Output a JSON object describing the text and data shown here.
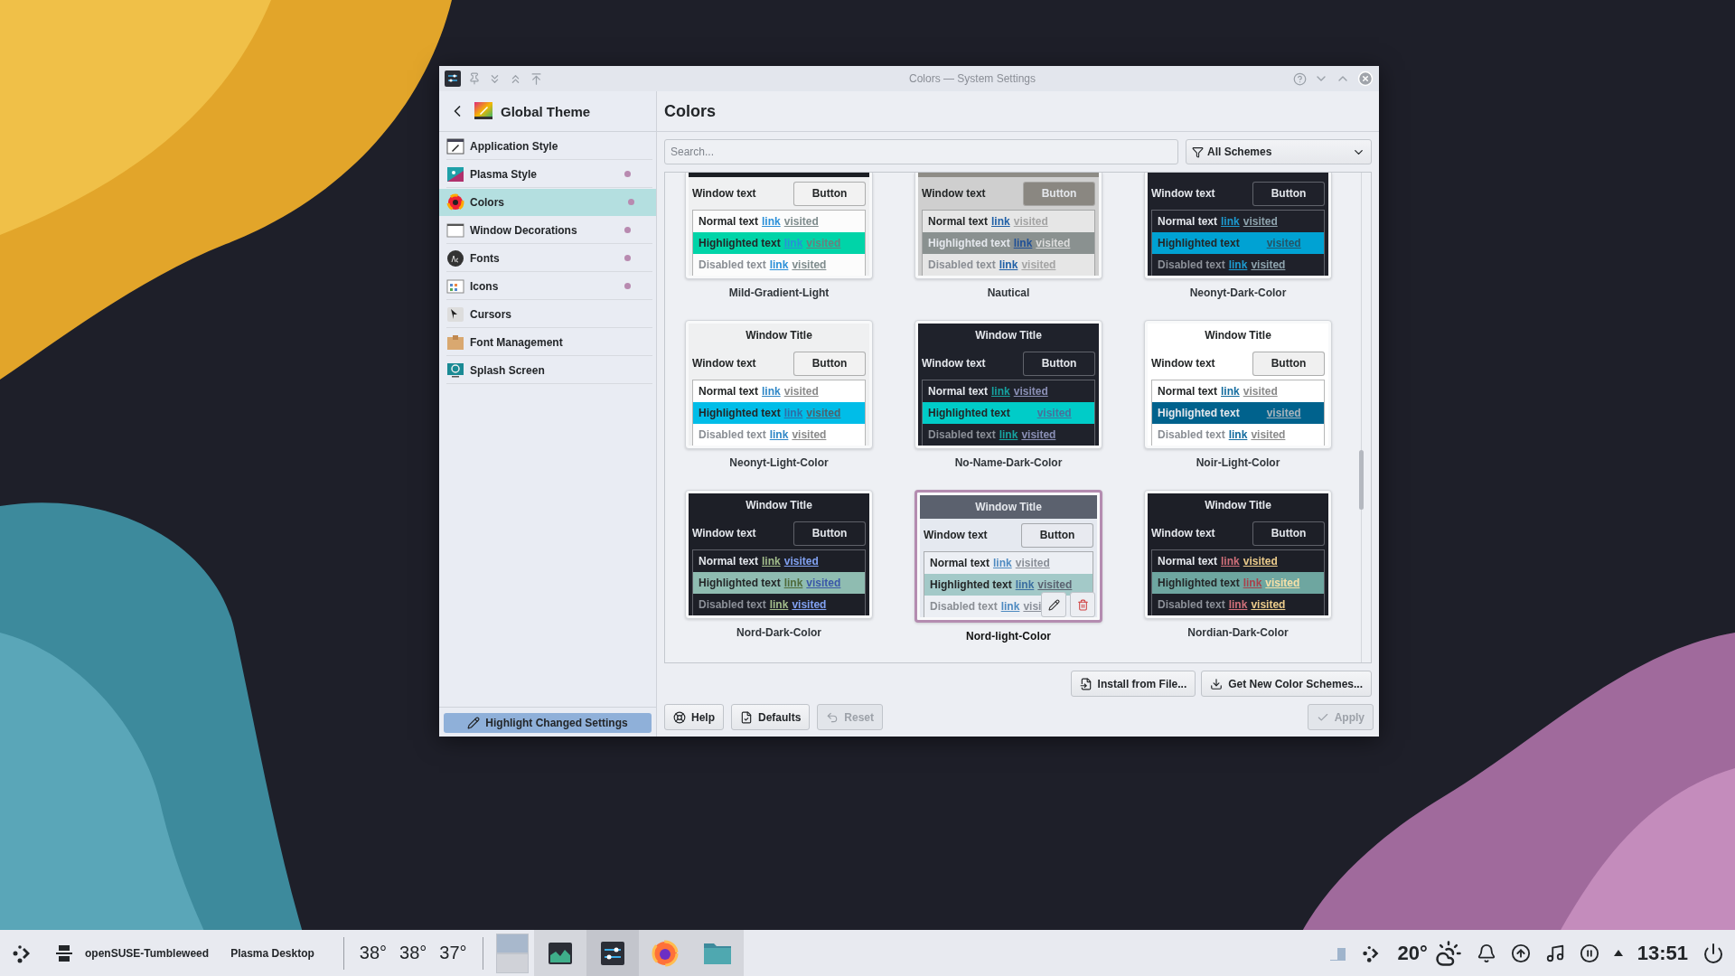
{
  "window": {
    "title": "Colors — System Settings"
  },
  "sidebar": {
    "header": "Global Theme",
    "items": [
      {
        "label": "Application Style",
        "selected": false,
        "changed": false
      },
      {
        "label": "Plasma Style",
        "selected": false,
        "changed": true
      },
      {
        "label": "Colors",
        "selected": true,
        "changed": true
      },
      {
        "label": "Window Decorations",
        "selected": false,
        "changed": true
      },
      {
        "label": "Fonts",
        "selected": false,
        "changed": true
      },
      {
        "label": "Icons",
        "selected": false,
        "changed": true
      },
      {
        "label": "Cursors",
        "selected": false,
        "changed": false
      },
      {
        "label": "Font Management",
        "selected": false,
        "changed": false
      },
      {
        "label": "Splash Screen",
        "selected": false,
        "changed": false
      }
    ],
    "highlight_button": "Highlight Changed Settings"
  },
  "page": {
    "title": "Colors",
    "search": {
      "placeholder": "Search..."
    },
    "filter": "All Schemes",
    "schemes": [
      {
        "name": "Mild-Gradient-Light",
        "selected": false,
        "title_bar": {
          "color": "#1b1e24"
        },
        "window": {
          "text": "Window text",
          "color": "#eff0f1"
        },
        "button": {
          "label": "Button",
          "color": "#f2f2f2"
        },
        "rows": [
          {
            "kind": "normal",
            "label": "Normal text",
            "color": "#fcfcfc",
            "link": {
              "text": "link",
              "color": "#2a8fd8"
            },
            "visited": {
              "text": "visited",
              "color": "#7f8c8d"
            }
          },
          {
            "kind": "highlighted",
            "label": "Highlighted text",
            "color": "#00d4a8",
            "link": {
              "text": "link",
              "color": "#2a8fd8"
            },
            "visited": {
              "text": "visited",
              "color": "#6f7c7d"
            }
          },
          {
            "kind": "disabled",
            "label": "Disabled text",
            "color": "#fcfcfc",
            "link": {
              "text": "link",
              "color": "#2a8fd8"
            },
            "visited": {
              "text": "visited",
              "color": "#7f8c8d"
            }
          }
        ]
      },
      {
        "name": "Nautical",
        "selected": false,
        "title_bar": {
          "color": "#8e8c86"
        },
        "window": {
          "text": "Window text",
          "color": "#cfcfcf"
        },
        "button": {
          "label": "Button",
          "color": "#8a8781"
        },
        "rows": [
          {
            "kind": "normal",
            "label": "Normal text",
            "color": "#e6e6e6",
            "link": {
              "text": "link",
              "color": "#1f5fa6"
            },
            "visited": {
              "text": "visited",
              "color": "#a4a4a4"
            }
          },
          {
            "kind": "highlighted",
            "label": "Highlighted text",
            "color": "#8a9190",
            "link": {
              "text": "link",
              "color": "#1f4f96"
            },
            "visited": {
              "text": "visited",
              "color": "#dcdcdc"
            }
          },
          {
            "kind": "disabled",
            "label": "Disabled text",
            "color": "#e6e6e6",
            "link": {
              "text": "link",
              "color": "#1f5fa6"
            },
            "visited": {
              "text": "visited",
              "color": "#a4a4a4"
            }
          }
        ]
      },
      {
        "name": "Neonyt-Dark-Color",
        "selected": false,
        "title_bar": {
          "color": "#1f212a"
        },
        "window": {
          "text": "Window text",
          "color": "#1f212a"
        },
        "button": {
          "label": "Button",
          "color": "#1f212a"
        },
        "rows": [
          {
            "kind": "normal",
            "label": "Normal text",
            "color": "#1f212a",
            "link": {
              "text": "link",
              "color": "#1d9bd1"
            },
            "visited": {
              "text": "visited",
              "color": "#8ea3ad"
            }
          },
          {
            "kind": "highlighted",
            "label": "Highlighted text",
            "color": "#00a2d3",
            "visited": {
              "text": "visited",
              "color": "#255466"
            }
          },
          {
            "kind": "disabled",
            "label": "Disabled text",
            "color": "#1f212a",
            "link": {
              "text": "link",
              "color": "#1d9bd1"
            },
            "visited": {
              "text": "visited",
              "color": "#8ea3ad"
            }
          }
        ]
      },
      {
        "name": "Neonyt-Light-Color",
        "selected": false,
        "title_bar": {
          "text": "Window Title",
          "color": "#eff0f1"
        },
        "window": {
          "text": "Window text",
          "color": "#eff0f1"
        },
        "button": {
          "label": "Button",
          "color": "#f2f2f2"
        },
        "rows": [
          {
            "kind": "normal",
            "label": "Normal text",
            "color": "#ffffff",
            "link": {
              "text": "link",
              "color": "#2e86c6"
            },
            "visited": {
              "text": "visited",
              "color": "#8a8a8a"
            }
          },
          {
            "kind": "highlighted",
            "label": "Highlighted text",
            "color": "#00bde8",
            "link": {
              "text": "link",
              "color": "#2e6ca6"
            },
            "visited": {
              "text": "visited",
              "color": "#50606a"
            }
          },
          {
            "kind": "disabled",
            "label": "Disabled text",
            "color": "#ffffff",
            "link": {
              "text": "link",
              "color": "#2e86c6"
            },
            "visited": {
              "text": "visited",
              "color": "#8a8a8a"
            }
          }
        ]
      },
      {
        "name": "No-Name-Dark-Color",
        "selected": false,
        "title_bar": {
          "text": "Window Title",
          "color": "#1f222b"
        },
        "window": {
          "text": "Window text",
          "color": "#1f222b"
        },
        "button": {
          "label": "Button",
          "color": "#1f222b"
        },
        "rows": [
          {
            "kind": "normal",
            "label": "Normal text",
            "color": "#1f222b",
            "link": {
              "text": "link",
              "color": "#16a3a0"
            },
            "visited": {
              "text": "visited",
              "color": "#8a8fb5"
            }
          },
          {
            "kind": "highlighted",
            "label": "Highlighted text",
            "color": "#00ccc8",
            "visited": {
              "text": "visited",
              "color": "#4a6f9a"
            }
          },
          {
            "kind": "disabled",
            "label": "Disabled text",
            "color": "#1f222b",
            "link": {
              "text": "link",
              "color": "#16a3a0"
            },
            "visited": {
              "text": "visited",
              "color": "#8a8fb5"
            }
          }
        ]
      },
      {
        "name": "Noir-Light-Color",
        "selected": false,
        "title_bar": {
          "text": "Window Title",
          "color": "#ffffff"
        },
        "window": {
          "text": "Window text",
          "color": "#ffffff"
        },
        "button": {
          "label": "Button",
          "color": "#f0f0f0"
        },
        "rows": [
          {
            "kind": "normal",
            "label": "Normal text",
            "color": "#ffffff",
            "link": {
              "text": "link",
              "color": "#136b9e"
            },
            "visited": {
              "text": "visited",
              "color": "#8a8a8a"
            }
          },
          {
            "kind": "highlighted",
            "label": "Highlighted text",
            "color": "#00628d",
            "visited": {
              "text": "visited",
              "color": "#a8b4bc"
            }
          },
          {
            "kind": "disabled",
            "label": "Disabled text",
            "color": "#ffffff",
            "link": {
              "text": "link",
              "color": "#136b9e"
            },
            "visited": {
              "text": "visited",
              "color": "#8a8a8a"
            }
          }
        ]
      },
      {
        "name": "Nord-Dark-Color",
        "selected": false,
        "title_bar": {
          "text": "Window Title",
          "color": "#1d1f27"
        },
        "window": {
          "text": "Window text",
          "color": "#1d1f27"
        },
        "button": {
          "label": "Button",
          "color": "#1d1f27"
        },
        "rows": [
          {
            "kind": "normal",
            "label": "Normal text",
            "color": "#1d1f27",
            "link": {
              "text": "link",
              "color": "#a3be8c"
            },
            "visited": {
              "text": "visited",
              "color": "#81a1f1"
            }
          },
          {
            "kind": "highlighted",
            "label": "Highlighted text",
            "color": "#8fbcb1",
            "link": {
              "text": "link",
              "color": "#4f6a3a"
            },
            "visited": {
              "text": "visited",
              "color": "#3a56a8"
            }
          },
          {
            "kind": "disabled",
            "label": "Disabled text",
            "color": "#1d1f27",
            "link": {
              "text": "link",
              "color": "#a3be8c"
            },
            "visited": {
              "text": "visited",
              "color": "#81a1f1"
            }
          }
        ]
      },
      {
        "name": "Nord-light-Color",
        "selected": true,
        "title_bar": {
          "text": "Window Title",
          "color": "#5b616e"
        },
        "window": {
          "text": "Window text",
          "color": "#e5e9f0"
        },
        "button": {
          "label": "Button",
          "color": "#e8eaf0"
        },
        "rows": [
          {
            "kind": "normal",
            "label": "Normal text",
            "color": "#eceff4",
            "link": {
              "text": "link",
              "color": "#4e8ac0"
            },
            "visited": {
              "text": "visited",
              "color": "#8a8f98"
            }
          },
          {
            "kind": "highlighted",
            "label": "Highlighted text",
            "color": "#a3c9c8",
            "link": {
              "text": "link",
              "color": "#3a6ea0"
            },
            "visited": {
              "text": "visited",
              "color": "#5a6270"
            }
          },
          {
            "kind": "disabled",
            "label": "Disabled text",
            "color": "#eceff4",
            "link": {
              "text": "link",
              "color": "#4e8ac0"
            },
            "visited": {
              "text": "visi",
              "color": "#8a8f98"
            }
          }
        ]
      },
      {
        "name": "Nordian-Dark-Color",
        "selected": false,
        "title_bar": {
          "text": "Window Title",
          "color": "#1d1f27"
        },
        "window": {
          "text": "Window text",
          "color": "#1d1f27"
        },
        "button": {
          "label": "Button",
          "color": "#1d1f27"
        },
        "rows": [
          {
            "kind": "normal",
            "label": "Normal text",
            "color": "#1d1f27",
            "link": {
              "text": "link",
              "color": "#d0707a"
            },
            "visited": {
              "text": "visited",
              "color": "#ebcb8b"
            }
          },
          {
            "kind": "highlighted",
            "label": "Highlighted text",
            "color": "#6ea6a0",
            "link": {
              "text": "link",
              "color": "#a8404a"
            },
            "visited": {
              "text": "visited",
              "color": "#f6e0a8"
            }
          },
          {
            "kind": "disabled",
            "label": "Disabled text",
            "color": "#1d1f27",
            "link": {
              "text": "link",
              "color": "#d0707a"
            },
            "visited": {
              "text": "visited",
              "color": "#ebcb8b"
            }
          }
        ]
      }
    ],
    "actions": [
      "Install from File...",
      "Get New Color Schemes..."
    ],
    "buttons": [
      {
        "kind": "help",
        "label": "Help",
        "disabled": false
      },
      {
        "kind": "defaults",
        "label": "Defaults",
        "disabled": false
      },
      {
        "kind": "reset",
        "label": "Reset",
        "disabled": true
      },
      {
        "kind": "apply",
        "label": "Apply",
        "disabled": true
      }
    ]
  },
  "taskbar": {
    "labels": [
      "openSUSE-Tumbleweed",
      "Plasma Desktop"
    ],
    "temperatures": [
      "38°",
      "38°",
      "37°"
    ],
    "tasks": [
      {
        "kind": "monitor",
        "selected": false
      },
      {
        "kind": "settings",
        "selected": true
      },
      {
        "kind": "firefox",
        "selected": false
      },
      {
        "kind": "files",
        "selected": false
      }
    ],
    "weather": "20°",
    "clock": "13:51"
  }
}
